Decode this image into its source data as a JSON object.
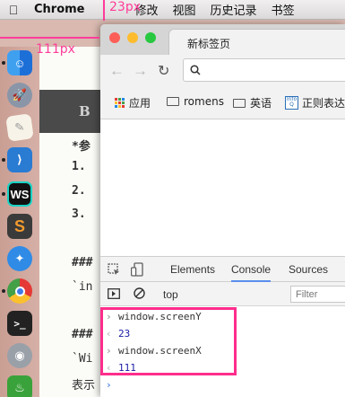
{
  "menubar": {
    "apple_icon": "apple-logo-icon",
    "app_name": "Chrome",
    "items": [
      "修改",
      "视图",
      "历史记录",
      "书签"
    ]
  },
  "annotations": {
    "top_measure": "23px",
    "left_measure": "111px",
    "color": "#ff3d9a"
  },
  "dock": {
    "apps": [
      "finder",
      "launchpad",
      "textedit",
      "vscode",
      "webstorm",
      "sublime-text",
      "safari",
      "chrome",
      "terminal",
      "disk-utility",
      "evernote"
    ]
  },
  "editor": {
    "toolbar_label": "B",
    "lines": [
      "*参",
      "1.",
      "2.",
      "3.",
      "###",
      "`in",
      "###",
      "`Wi",
      "表示"
    ]
  },
  "chrome": {
    "tab_title": "新标签页",
    "omnibox_icon": "search-icon",
    "bookmarks": [
      {
        "label": "应用",
        "icon": "apps-grid-icon"
      },
      {
        "label": "romens",
        "icon": "folder-icon"
      },
      {
        "label": "英语",
        "icon": "folder-icon"
      },
      {
        "label": "正则表达",
        "icon": "infoq-icon"
      }
    ]
  },
  "devtools": {
    "tabs": [
      "Elements",
      "Console",
      "Sources"
    ],
    "active_tab": "Console",
    "context": "top",
    "filter_placeholder": "Filter",
    "console": [
      {
        "type": "input",
        "text": "window.screenY"
      },
      {
        "type": "output",
        "text": "23"
      },
      {
        "type": "input",
        "text": "window.screenX"
      },
      {
        "type": "output",
        "text": "111"
      },
      {
        "type": "prompt",
        "text": ""
      }
    ]
  }
}
